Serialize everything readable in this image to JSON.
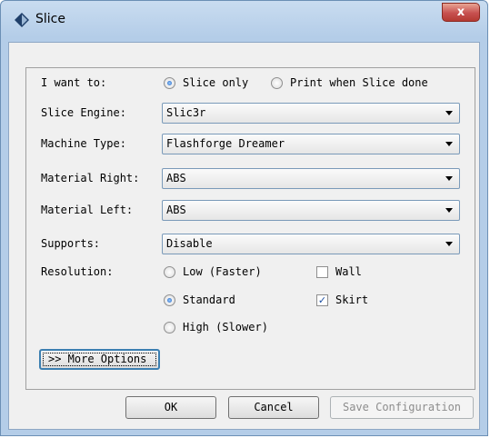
{
  "window": {
    "title": "Slice",
    "close_label": "x"
  },
  "form": {
    "want_label": "I want to:",
    "want_options": [
      "Slice only",
      "Print when Slice done"
    ],
    "engine_label": "Slice Engine:",
    "engine_value": "Slic3r",
    "machine_label": "Machine Type:",
    "machine_value": "Flashforge Dreamer",
    "material_right_label": "Material Right:",
    "material_right_value": "ABS",
    "material_left_label": "Material Left:",
    "material_left_value": "ABS",
    "supports_label": "Supports:",
    "supports_value": "Disable",
    "resolution_label": "Resolution:",
    "resolution_options": [
      "Low (Faster)",
      "Standard",
      "High (Slower)"
    ],
    "wall_label": "Wall",
    "skirt_label": "Skirt",
    "more_options_label": ">> More Options"
  },
  "state": {
    "want_selected": "Slice only",
    "resolution_selected": "Standard",
    "wall_checked": false,
    "skirt_checked": true
  },
  "buttons": {
    "ok": "OK",
    "cancel": "Cancel",
    "save": "Save Configuration"
  },
  "colors": {
    "accent": "#3c7fb1",
    "close": "#c75050"
  }
}
